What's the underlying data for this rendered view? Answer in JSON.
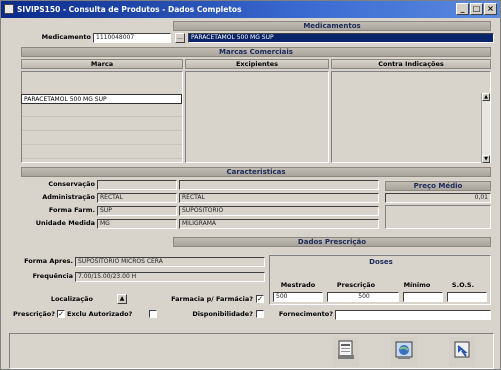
{
  "window": {
    "title": "SIVIPS150 - Consulta de Produtos - Dados Completos",
    "buttons": [
      "_",
      "□",
      "×"
    ]
  },
  "medicamentos": {
    "header": "Medicamentos",
    "label": "Medicamento",
    "code": "1110048007",
    "name": "PARACETAMOL 500 MG SUP"
  },
  "marcas": {
    "header": "Marcas Comerciais",
    "columns": [
      "Marca",
      "Excipientes",
      "Contra Indicações"
    ],
    "rows": [
      "PARACETAMOL 500 MG SUP",
      "",
      "",
      "",
      ""
    ]
  },
  "caracteristicas": {
    "header": "Caracteristicas",
    "fields": [
      {
        "label": "Conservação",
        "code": "",
        "value": ""
      },
      {
        "label": "Administração",
        "code": "RECTAL",
        "value": "RECTAL"
      },
      {
        "label": "Forma Farm.",
        "code": "SUP",
        "value": "SUPOSITORIO"
      },
      {
        "label": "Unidade Medida",
        "code": "MG",
        "value": "MILIGRAMA"
      }
    ],
    "preco_label": "Preço Médio",
    "preco_value": "0,01"
  },
  "prescricao": {
    "header": "Dados Prescrição",
    "forma_label": "Forma Apres.",
    "forma_value": "SUPOSITORIO MICROS CERA",
    "frequencia_label": "Frequência",
    "frequencia_value": "7.00/15.00/23.00 H",
    "doses_header": "Doses",
    "doses_columns": [
      "Mestrado",
      "Prescrição",
      "Mínimo",
      "S.O.S."
    ],
    "doses_values": [
      "500",
      "500",
      "",
      ""
    ],
    "localizacao_label": "Localização",
    "farmacia_label": "Farmacia p/ Farmácia?",
    "farmacia_checked": "✓",
    "prescricao_label": "Prescrição?",
    "prescricao_checked": "✓",
    "exclusivo_label": "Exclu Autorizado?",
    "exclusivo_checked": "",
    "disponibilidade_label": "Disponibilidade?",
    "disponibilidade_checked": "",
    "fornecimento_label": "Fornecimento?",
    "fornecimento_value": ""
  },
  "toolbar": {
    "icons": [
      "print-icon",
      "web-icon",
      "exit-icon"
    ]
  }
}
